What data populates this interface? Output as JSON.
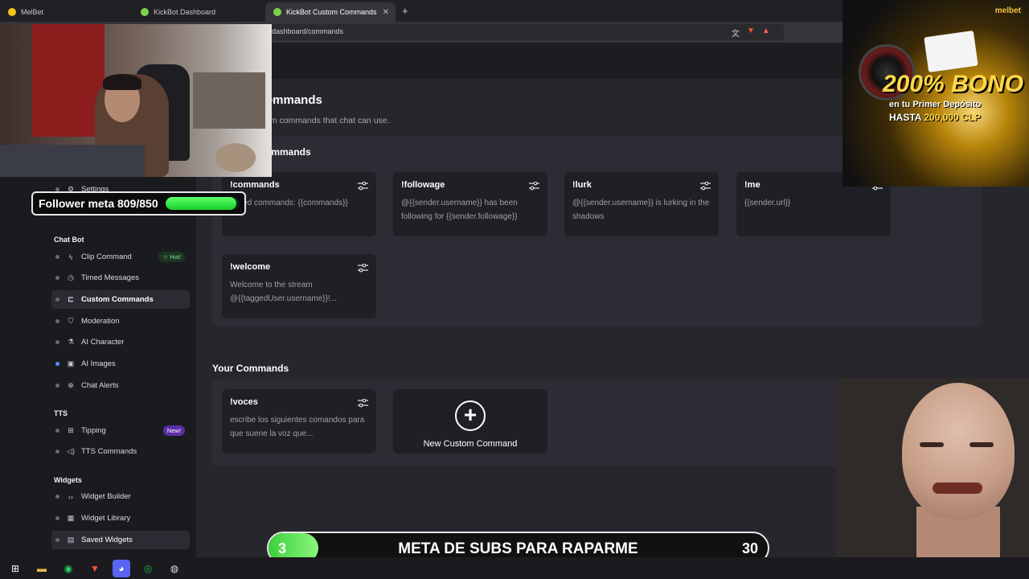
{
  "browser": {
    "tabs": [
      {
        "label": "MelBet",
        "color": "#f5c518"
      },
      {
        "label": "KickBot Dashboard",
        "color": "#7bd34a"
      },
      {
        "label": "KickBot Custom Commands",
        "color": "#7bd34a"
      }
    ],
    "url": "dashboard/commands"
  },
  "sidebar": {
    "hidden_item": "Settings",
    "sections": {
      "chat_bot": "Chat Bot",
      "tts": "TTS",
      "widgets": "Widgets"
    },
    "items": [
      {
        "label": "Clip Command",
        "icon": "bolt-icon",
        "badge": "☆ Hot!"
      },
      {
        "label": "Timed Messages",
        "icon": "clock-icon"
      },
      {
        "label": "Custom Commands",
        "icon": "tag-icon"
      },
      {
        "label": "Moderation",
        "icon": "shield-icon"
      },
      {
        "label": "AI Character",
        "icon": "flask-icon"
      },
      {
        "label": "AI Images",
        "icon": "image-icon"
      },
      {
        "label": "Chat Alerts",
        "icon": "globe-icon"
      },
      {
        "label": "Tipping",
        "icon": "gift-icon",
        "badge": "New!"
      },
      {
        "label": "TTS Commands",
        "icon": "speaker-icon"
      },
      {
        "label": "Widget Builder",
        "icon": "code-icon"
      },
      {
        "label": "Widget Library",
        "icon": "grid-icon"
      },
      {
        "label": "Saved Widgets",
        "icon": "save-icon"
      }
    ]
  },
  "main": {
    "title": "ommands",
    "subtitle": "om commands that chat can use.",
    "default_heading": "ommands",
    "default_commands": [
      {
        "name": "!commands",
        "desc": "...bled commands: {{commands}}"
      },
      {
        "name": "!followage",
        "desc": "@{{sender.username}} has been following for {{sender.followage}}"
      },
      {
        "name": "!lurk",
        "desc": "@{{sender.username}} is lurking in the shadows"
      },
      {
        "name": "!me",
        "desc": "{{sender.url}}"
      },
      {
        "name": "!welcome",
        "desc": "Welcome to the stream @{{taggedUser.username}}!..."
      }
    ],
    "your_heading": "Your Commands",
    "your_commands": [
      {
        "name": "!voces",
        "desc": "escribe los siguientes comandos para que suene la voz que..."
      }
    ],
    "new_command_label": "New Custom Command"
  },
  "overlays": {
    "follower_text": "Follower meta 809/850",
    "follower_progress": 0.952,
    "ad": {
      "brand": "melbet",
      "headline": "200% BONO",
      "line2": "en tu Primer Depósito",
      "line3_prefix": "HASTA",
      "line3_amount": "200,000 CLP"
    },
    "subgoal": {
      "current": "3",
      "text": "META DE SUBS PARA RAPARME",
      "target": "30",
      "progress": 0.1
    }
  },
  "accent": "#26272d"
}
